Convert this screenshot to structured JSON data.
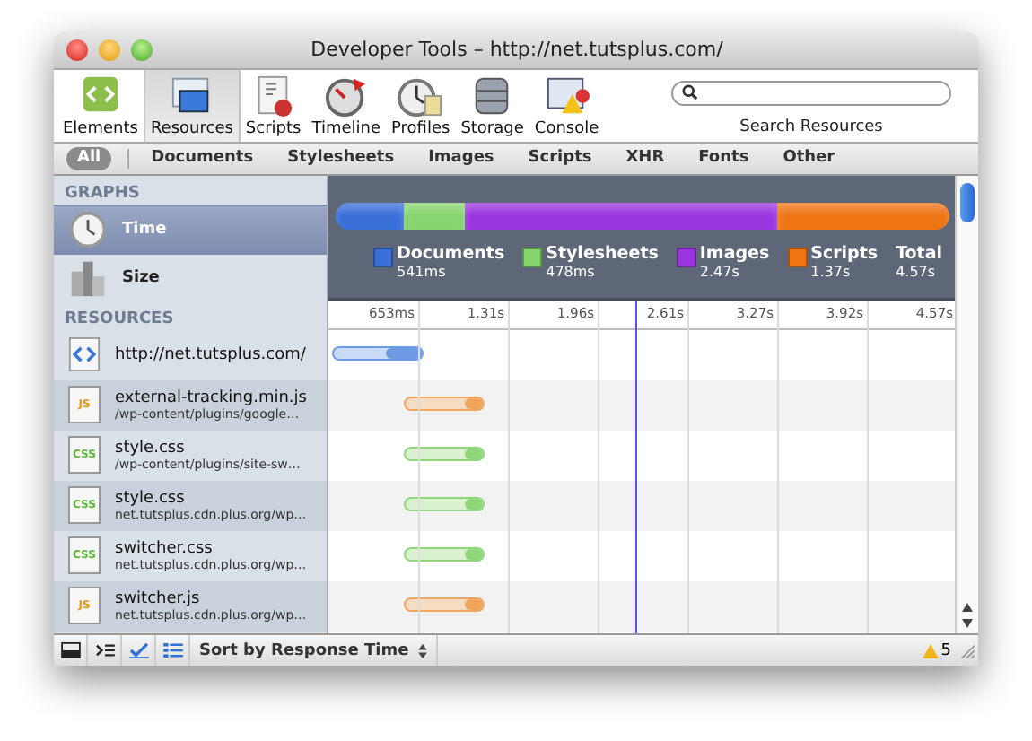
{
  "window": {
    "title": "Developer Tools – http://net.tutsplus.com/"
  },
  "toolbar": {
    "items": [
      {
        "label": "Elements",
        "kind": "elements",
        "selected": false
      },
      {
        "label": "Resources",
        "kind": "resources",
        "selected": true
      },
      {
        "label": "Scripts",
        "kind": "scripts",
        "selected": false
      },
      {
        "label": "Timeline",
        "kind": "timeline",
        "selected": false
      },
      {
        "label": "Profiles",
        "kind": "profiles",
        "selected": false
      },
      {
        "label": "Storage",
        "kind": "storage",
        "selected": false
      },
      {
        "label": "Console",
        "kind": "console",
        "selected": false
      }
    ],
    "search": {
      "label": "Search Resources"
    }
  },
  "filters": [
    {
      "label": "All",
      "selected": true
    },
    {
      "label": "Documents",
      "selected": false
    },
    {
      "label": "Stylesheets",
      "selected": false
    },
    {
      "label": "Images",
      "selected": false
    },
    {
      "label": "Scripts",
      "selected": false
    },
    {
      "label": "XHR",
      "selected": false
    },
    {
      "label": "Fonts",
      "selected": false
    },
    {
      "label": "Other",
      "selected": false
    }
  ],
  "sidebar": {
    "graphs_heading": "GRAPHS",
    "graphs": [
      {
        "label": "Time",
        "kind": "time",
        "selected": true
      },
      {
        "label": "Size",
        "kind": "size",
        "selected": false
      }
    ],
    "resources_heading": "RESOURCES",
    "resources": [
      {
        "name": "http://net.tutsplus.com/",
        "kind": "document"
      },
      {
        "name": "external-tracking.min.js",
        "path": "/wp-content/plugins/google…",
        "kind": "script",
        "badge": "JS"
      },
      {
        "name": "style.css",
        "path": "/wp-content/plugins/site-sw…",
        "kind": "stylesheet",
        "badge": "CSS"
      },
      {
        "name": "style.css",
        "path": "net.tutsplus.cdn.plus.org/wp…",
        "kind": "stylesheet",
        "badge": "CSS"
      },
      {
        "name": "switcher.css",
        "path": "net.tutsplus.cdn.plus.org/wp…",
        "kind": "stylesheet",
        "badge": "CSS"
      },
      {
        "name": "switcher.js",
        "path": "net.tutsplus.cdn.plus.org/wp…",
        "kind": "script",
        "badge": "JS"
      }
    ]
  },
  "summary": {
    "legend": [
      {
        "label": "Documents",
        "value": "541ms",
        "color": "#3b6fd8"
      },
      {
        "label": "Stylesheets",
        "value": "478ms",
        "color": "#86d46e"
      },
      {
        "label": "Images",
        "value": "2.47s",
        "color": "#9a35e0"
      },
      {
        "label": "Scripts",
        "value": "1.37s",
        "color": "#ee7414"
      }
    ],
    "total": {
      "label": "Total",
      "value": "4.57s"
    }
  },
  "timeline": {
    "ruler": [
      "653ms",
      "1.31s",
      "1.96s",
      "2.61s",
      "3.27s",
      "3.92s",
      "4.57s"
    ]
  },
  "status_bar": {
    "sort": "Sort by Response Time",
    "warnings": "5"
  }
}
